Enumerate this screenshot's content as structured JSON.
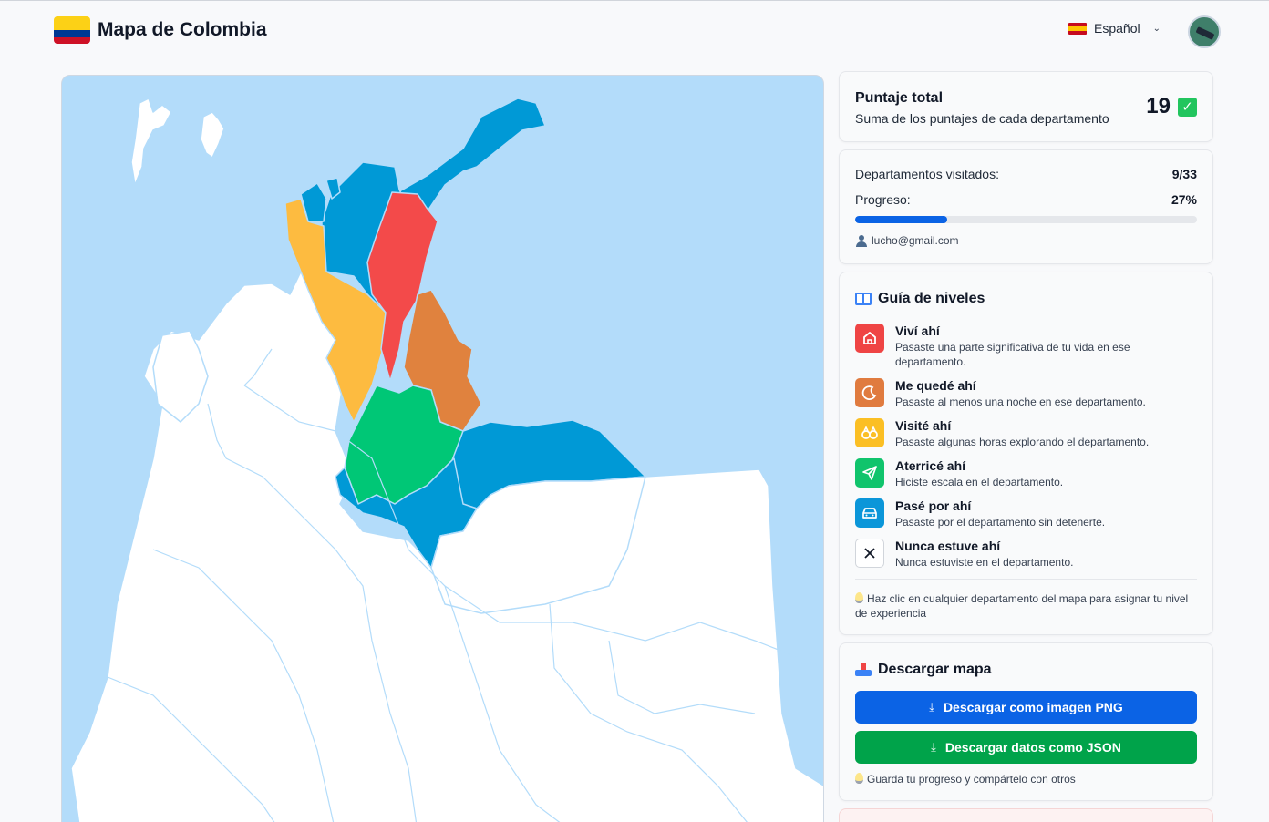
{
  "header": {
    "title": "Mapa de Colombia",
    "language": "Español"
  },
  "score": {
    "title": "Puntaje total",
    "subtitle": "Suma de los puntajes de cada departamento",
    "value": "19"
  },
  "progress": {
    "visited_label": "Departamentos visitados:",
    "visited_value": "9/33",
    "progress_label": "Progreso:",
    "progress_value": "27%",
    "progress_fraction": 0.27,
    "email": "lucho@gmail.com"
  },
  "guide": {
    "title": "Guía de niveles",
    "levels": [
      {
        "name": "Viví ahí",
        "desc": "Pasaste una parte significativa de tu vida en ese departamento.",
        "color": "#ef4444",
        "icon": "house-icon"
      },
      {
        "name": "Me quedé ahí",
        "desc": "Pasaste al menos una noche en ese departamento.",
        "color": "#e07b3f",
        "icon": "moon-icon"
      },
      {
        "name": "Visité ahí",
        "desc": "Pasaste algunas horas explorando el departamento.",
        "color": "#fbbf24",
        "icon": "binoculars-icon"
      },
      {
        "name": "Aterricé ahí",
        "desc": "Hiciste escala en el departamento.",
        "color": "#10c46c",
        "icon": "paper-plane-icon"
      },
      {
        "name": "Pasé por ahí",
        "desc": "Pasaste por el departamento sin detenerte.",
        "color": "#0b96d9",
        "icon": "car-icon"
      },
      {
        "name": "Nunca estuve ahí",
        "desc": "Nunca estuviste en el departamento.",
        "color": "#ffffff",
        "icon": "close-icon"
      }
    ],
    "tip": "Haz clic en cualquier departamento del mapa para asignar tu nivel de experiencia"
  },
  "download": {
    "title": "Descargar mapa",
    "png_label": "Descargar como imagen PNG",
    "json_label": "Descargar datos como JSON",
    "note": "Guarda tu progreso y compártelo con otros"
  },
  "map": {
    "sea_color": "#b3dcfa",
    "unvisited_color": "#ffffff"
  }
}
